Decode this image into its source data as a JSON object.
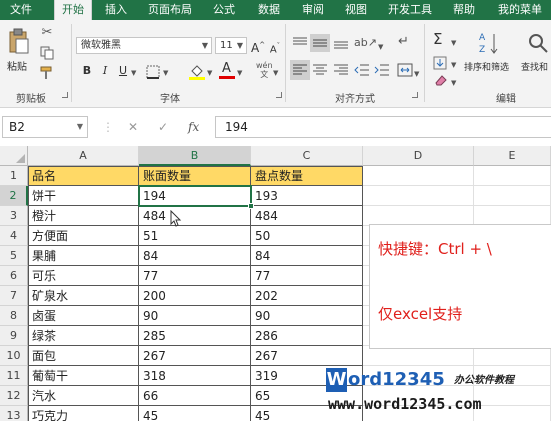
{
  "ribbon_tabs": [
    {
      "label": "文件",
      "active": false
    },
    {
      "label": "开始",
      "active": true
    },
    {
      "label": "插入",
      "active": false
    },
    {
      "label": "页面布局",
      "active": false
    },
    {
      "label": "公式",
      "active": false
    },
    {
      "label": "数据",
      "active": false
    },
    {
      "label": "审阅",
      "active": false
    },
    {
      "label": "视图",
      "active": false
    },
    {
      "label": "开发工具",
      "active": false
    },
    {
      "label": "帮助",
      "active": false
    },
    {
      "label": "我的菜单",
      "active": false
    }
  ],
  "clipboard": {
    "paste_label": "粘贴",
    "group_label": "剪贴板"
  },
  "font": {
    "name": "微软雅黑",
    "size": "11",
    "group_label": "字体",
    "bold": "B",
    "italic": "I",
    "underline": "U",
    "grow": "A",
    "shrink": "A",
    "font_color_letter": "A",
    "phonetic": "wén"
  },
  "alignment": {
    "group_label": "对齐方式"
  },
  "editing": {
    "sort_filter_label": "排序和筛选",
    "find_select_label": "查找和",
    "group_label": "编辑",
    "sigma": "Σ"
  },
  "formula_bar": {
    "name_box": "B2",
    "cancel": "✕",
    "enter": "✓",
    "fx": "fx",
    "value": "194"
  },
  "columns": [
    "A",
    "B",
    "C",
    "D",
    "E"
  ],
  "rows": [
    "1",
    "2",
    "3",
    "4",
    "5",
    "6",
    "7",
    "8",
    "9",
    "10",
    "11",
    "12",
    "13"
  ],
  "table": {
    "headers": [
      "品名",
      "账面数量",
      "盘点数量"
    ],
    "rows": [
      [
        "饼干",
        "194",
        "193"
      ],
      [
        "橙汁",
        "484",
        "484"
      ],
      [
        "方便面",
        "51",
        "50"
      ],
      [
        "果脯",
        "84",
        "84"
      ],
      [
        "可乐",
        "77",
        "77"
      ],
      [
        "矿泉水",
        "200",
        "202"
      ],
      [
        "卤蛋",
        "90",
        "90"
      ],
      [
        "绿茶",
        "285",
        "286"
      ],
      [
        "面包",
        "267",
        "267"
      ],
      [
        "葡萄干",
        "318",
        "319"
      ],
      [
        "汽水",
        "66",
        "65"
      ],
      [
        "巧克力",
        "45",
        "45"
      ]
    ]
  },
  "selection": {
    "active_cell": "B2"
  },
  "callout": {
    "line1": "快捷键：Ctrl + \\",
    "line2": "仅excel支持",
    "color": "#e0201c"
  },
  "watermark": {
    "brand_w": "W",
    "brand_rest": "ord12345",
    "slogan": "办公软件教程",
    "url": "www.word12345.com"
  },
  "colors": {
    "accent": "#217346",
    "header_fill": "#ffd966",
    "watermark_blue": "#1e5fb4"
  }
}
